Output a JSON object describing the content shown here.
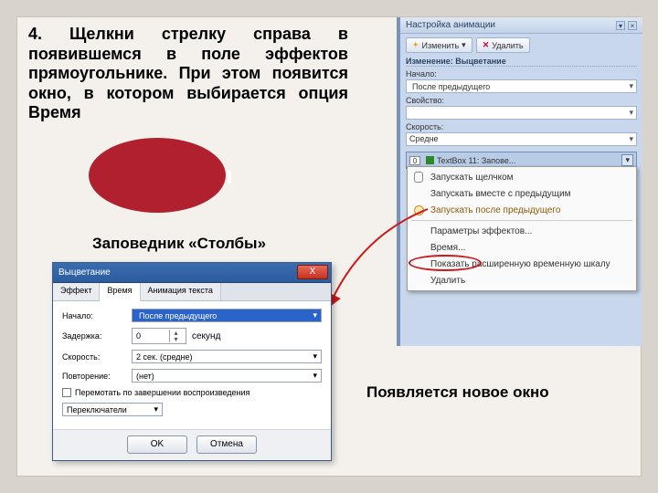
{
  "instruction": "4. Щелкни стрелку справа в появившемся в поле эффектов прямоугольнике. При этом появится окно, в котором выбирается опция Время",
  "subtitle": "Заповедник «Столбы»",
  "bottom_caption": "Появляется новое окно",
  "anim_pane": {
    "title": "Настройка анимации",
    "btn_change": "Изменить",
    "btn_remove": "Удалить",
    "section_title": "Изменение: Выцветание",
    "label_start": "Начало:",
    "val_start": "После предыдущего",
    "label_prop": "Свойство:",
    "label_speed": "Скорость:",
    "val_speed": "Средне",
    "effect_num": "0",
    "effect_name": "TextBox 11: Запове..."
  },
  "context_menu": {
    "i1": "Запускать щелчком",
    "i2": "Запускать вместе с предыдущим",
    "i3": "Запускать после предыдущего",
    "i4": "Параметры эффектов...",
    "i5": "Время...",
    "i6": "Показать расширенную временную шкалу",
    "i7": "Удалить"
  },
  "dialog": {
    "title": "Выцветание",
    "tab1": "Эффект",
    "tab2": "Время",
    "tab3": "Анимация текста",
    "lbl_start": "Начало:",
    "val_start": "После предыдущего",
    "lbl_delay": "Задержка:",
    "val_delay": "0",
    "unit_delay": "секунд",
    "lbl_speed": "Скорость:",
    "val_speed": "2 сек. (средне)",
    "lbl_repeat": "Повторение:",
    "val_repeat": "(нет)",
    "chk": "Перемотать по завершении воспроизведения",
    "btn_triggers": "Переключатели",
    "btn_ok": "OK",
    "btn_cancel": "Отмена"
  }
}
